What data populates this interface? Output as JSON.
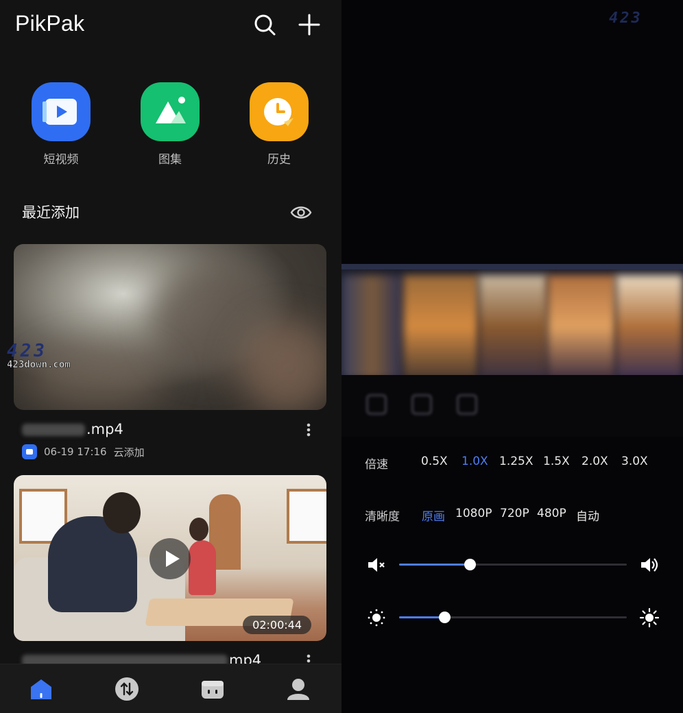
{
  "app": {
    "title": "PikPak"
  },
  "shortcuts": [
    {
      "label": "短视频",
      "icon": "play-video-icon",
      "color": "#2f6ef2"
    },
    {
      "label": "图集",
      "icon": "image-album-icon",
      "color": "#15c070"
    },
    {
      "label": "历史",
      "icon": "clock-history-icon",
      "color": "#f8a612"
    }
  ],
  "recent": {
    "title": "最近添加",
    "items": [
      {
        "name_suffix": ".mp4",
        "date": "06-19 17:16",
        "source": "云添加"
      },
      {
        "name_suffix": "mp4",
        "duration": "02:00:44"
      }
    ]
  },
  "player": {
    "speed": {
      "label": "倍速",
      "options": [
        "0.5X",
        "1.0X",
        "1.25X",
        "1.5X",
        "2.0X",
        "3.0X"
      ],
      "selected": "1.0X"
    },
    "quality": {
      "label": "清晰度",
      "options": [
        "原画",
        "1080P",
        "720P",
        "480P",
        "自动"
      ],
      "selected": "原画"
    },
    "volume_level": 0.31,
    "brightness_level": 0.2
  },
  "watermark": {
    "logo": "423",
    "sub": "DOWN",
    "site": "423down.com"
  },
  "colors": {
    "accent": "#4f7df0",
    "background_left": "#131313",
    "background_right": "#050508"
  }
}
